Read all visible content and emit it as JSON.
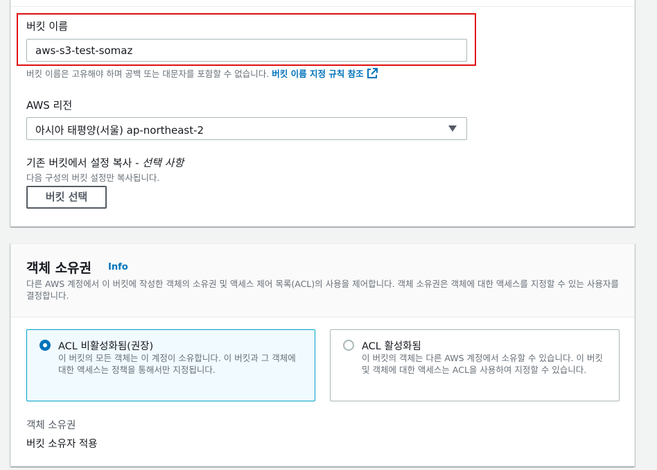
{
  "bucket_config": {
    "bucket_name_label": "버킷 이름",
    "bucket_name_value": "aws-s3-test-somaz",
    "bucket_name_hint": "버킷 이름은 고유해야 하며 공백 또는 대문자를 포함할 수 없습니다.",
    "bucket_name_rules_link": "버킷 이름 지정 규칙 참조",
    "region_label": "AWS 리전",
    "region_value": "아시아 태평양(서울) ap-northeast-2",
    "copy_settings_label": "기존 버킷에서 설정 복사 -",
    "copy_settings_optional": "선택 사항",
    "copy_settings_hint": "다음 구성의 버킷 설정만 복사됩니다.",
    "choose_bucket_button": "버킷 선택"
  },
  "object_ownership": {
    "title": "객체 소유권",
    "info_link": "Info",
    "description": "다른 AWS 계정에서 이 버킷에 작성한 객체의 소유권 및 액세스 제어 목록(ACL)의 사용을 제어합니다. 객체 소유권은 객체에 대한 액세스를 지정할 수 있는 사용자를 결정합니다.",
    "options": [
      {
        "title": "ACL 비활성화됨(권장)",
        "description": "이 버킷의 모든 객체는 이 계정이 소유합니다. 이 버킷과 그 객체에 대한 액세스는 정책을 통해서만 지정됩니다.",
        "selected": true
      },
      {
        "title": "ACL 활성화됨",
        "description": "이 버킷의 객체는 다른 AWS 계정에서 소유할 수 있습니다. 이 버킷 및 객체에 대한 액세스는 ACL을 사용하여 지정할 수 있습니다.",
        "selected": false
      }
    ],
    "summary_key": "객체 소유권",
    "summary_value": "버킷 소유자 적용"
  },
  "colors": {
    "highlight_border": "#e01010",
    "link": "#0073bb",
    "selected_tile_bg": "#f1faff",
    "selected_tile_border": "#00a1c9"
  }
}
